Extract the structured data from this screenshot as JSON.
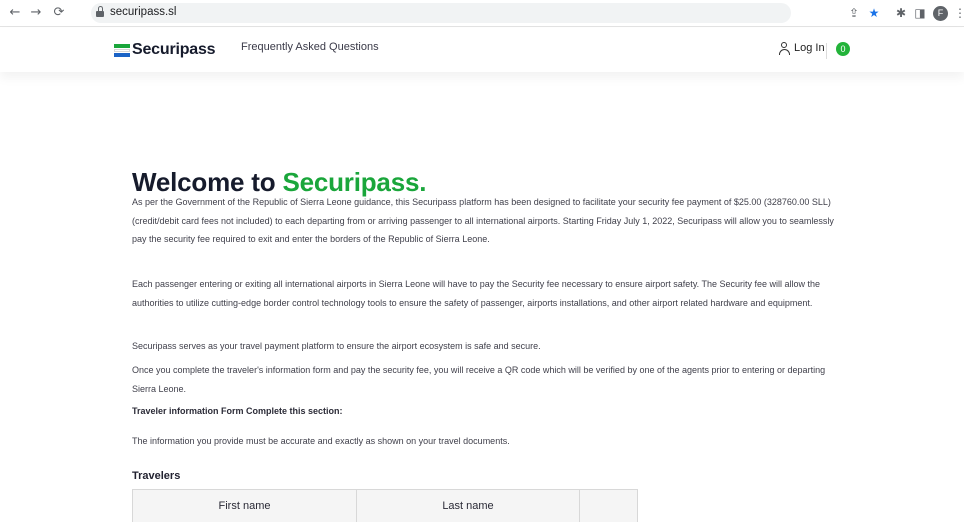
{
  "browser": {
    "url": "securipass.sl",
    "back_icon": "arrow-left-icon",
    "forward_icon": "arrow-right-icon",
    "reload_icon": "reload-icon",
    "profile_initial": "F"
  },
  "header": {
    "logo_text": "Securipass",
    "nav_faq": "Frequently Asked Questions",
    "login_label": "Log In",
    "cart_count": "0"
  },
  "main": {
    "title_prefix": "Welcome to ",
    "title_brand": "Securipass.",
    "paragraphs": [
      "As per the Government of the Republic of Sierra Leone guidance, this Securipass platform has been designed to facilitate your security fee payment of $25.00 (328760.00 SLL) (credit/debit card fees not included) to each departing from or arriving passenger to all international airports. Starting Friday July 1, 2022, Securipass will allow you to seamlessly pay the security fee required to exit and enter the borders of the Republic of Sierra Leone.",
      "Each passenger entering or exiting all international airports in Sierra Leone will have to pay the Security fee necessary to ensure airport safety. The Security fee will allow the authorities to utilize cutting-edge border control technology tools to ensure the safety of passenger, airports installations, and other airport related hardware and equipment.",
      "Securipass serves as your travel payment platform to ensure the airport ecosystem is safe and secure.",
      "Once you complete the traveler's information form and pay the security fee, you will receive a QR code which will be verified by one of the agents prior to entering or departing Sierra Leone.",
      "Traveler information Form Complete this section:",
      "The information you provide must be accurate and exactly as shown on your travel documents."
    ],
    "travelers_heading": "Travelers",
    "table_columns": [
      "First name",
      "Last name",
      ""
    ]
  },
  "colors": {
    "brand_green": "#1aa63b",
    "brand_blue": "#1b63c6",
    "title_dark": "#161b2c",
    "badge_green": "#23b33a"
  }
}
